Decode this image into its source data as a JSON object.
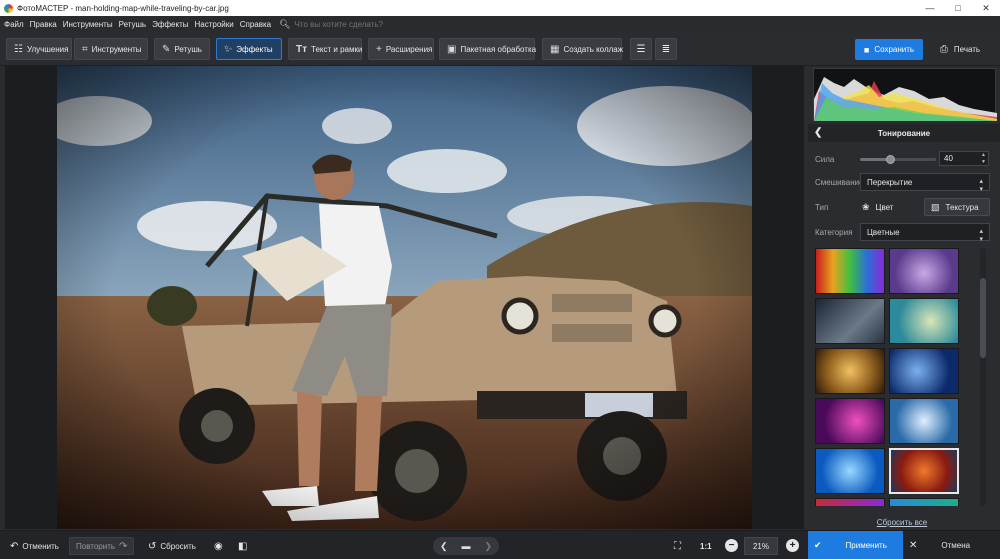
{
  "window": {
    "title": "ФотоМАСТЕР - man-holding-map-while-traveling-by-car.jpg",
    "controls": [
      "—",
      "□",
      "✕"
    ]
  },
  "menu": {
    "items": [
      "Файл",
      "Правка",
      "Инструменты",
      "Ретушь",
      "Эффекты",
      "Настройки",
      "Справка"
    ],
    "search_placeholder": "Что вы хотите сделать?"
  },
  "toolbar": {
    "tabs": [
      {
        "label": "Улучшения",
        "icon": "sliders-icon"
      },
      {
        "label": "Инструменты",
        "icon": "crop-icon"
      },
      {
        "label": "Ретушь",
        "icon": "brush-icon"
      },
      {
        "label": "Эффекты",
        "icon": "magic-wand-icon",
        "active": true
      },
      {
        "label": "Текст и рамки",
        "icon": "text-icon"
      },
      {
        "label": "Расширения",
        "icon": "plus-icon"
      }
    ],
    "batch_label": "Пакетная обработка",
    "collage_label": "Создать коллаж",
    "save_label": "Сохранить",
    "print_label": "Печать"
  },
  "panel": {
    "title": "Тонирование",
    "strength_label": "Сила",
    "strength_value": "40",
    "strength_fraction": 0.4,
    "blend_label": "Смешивание",
    "blend_value": "Перекрытие",
    "type_label": "Тип",
    "type_color": "Цвет",
    "type_texture": "Текстура",
    "category_label": "Категория",
    "category_value": "Цветные",
    "reset_all": "Сбросить все"
  },
  "bottom": {
    "undo": "Отменить",
    "redo": "Повторить",
    "reset": "Сбросить",
    "ratio": "1:1",
    "zoom": "21%",
    "apply": "Применить",
    "cancel": "Отмена"
  },
  "colors": {
    "accent": "#1e7be0",
    "background": "#2b2c30"
  }
}
